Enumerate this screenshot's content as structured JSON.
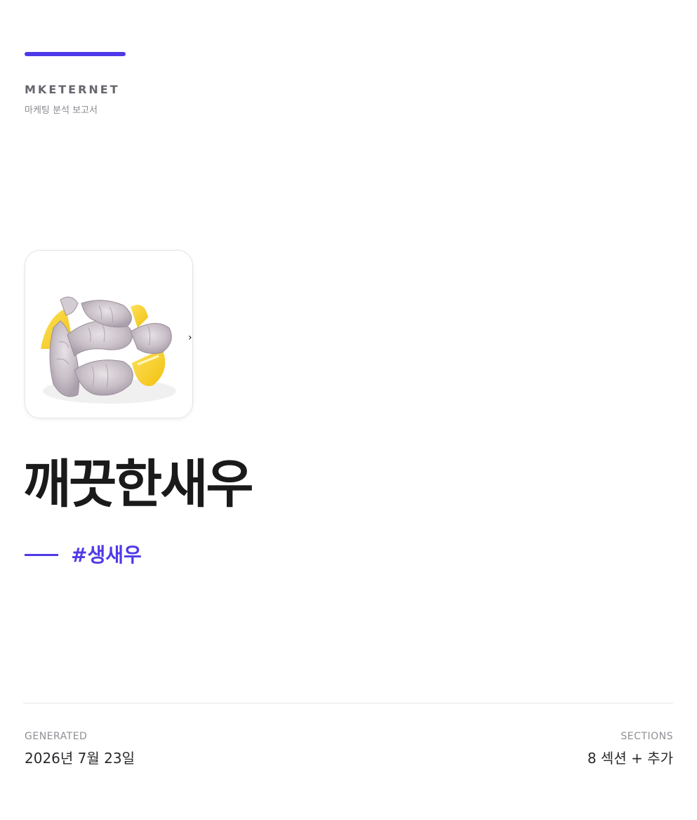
{
  "brand": {
    "name": "MKETERNET",
    "subtitle": "마케팅 분석 보고서",
    "accent_color": "#4f3ae8"
  },
  "product": {
    "image_icon": "shrimp-photo",
    "next_icon": "chevron-right-icon",
    "next_glyph": "›",
    "title": "깨끗한새우",
    "tag": "#생새우"
  },
  "footer": {
    "generated_label": "GENERATED",
    "generated_value": "2026년 7월 23일",
    "sections_label": "SECTIONS",
    "sections_value": "8 섹션 + 추가"
  }
}
